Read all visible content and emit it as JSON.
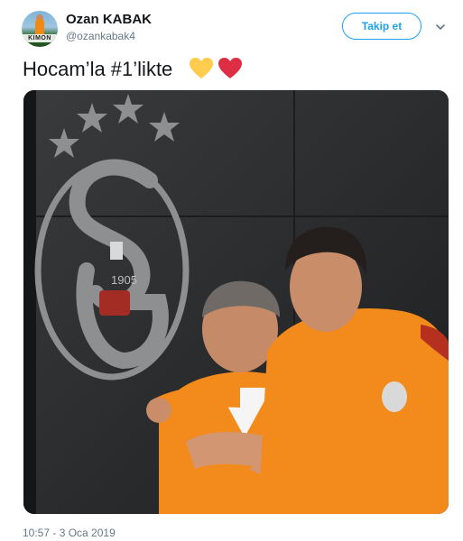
{
  "user": {
    "display_name": "Ozan KABAK",
    "handle": "@ozankabak4",
    "avatar_banner_text": "KIMON"
  },
  "follow_button": {
    "label": "Takip et"
  },
  "tweet": {
    "text": "Hocam’la #1’likte",
    "emojis": [
      "yellow-heart",
      "red-heart"
    ],
    "timestamp": "10:57 - 3 Oca 2019"
  },
  "photo": {
    "crest_year": "1905",
    "colors": {
      "orange": "#f28a1c",
      "wall": "#2a2b2d",
      "crest": "#8e8f91"
    }
  },
  "colors": {
    "accent": "#1da1f2",
    "muted": "#657786",
    "text": "#14171a"
  }
}
